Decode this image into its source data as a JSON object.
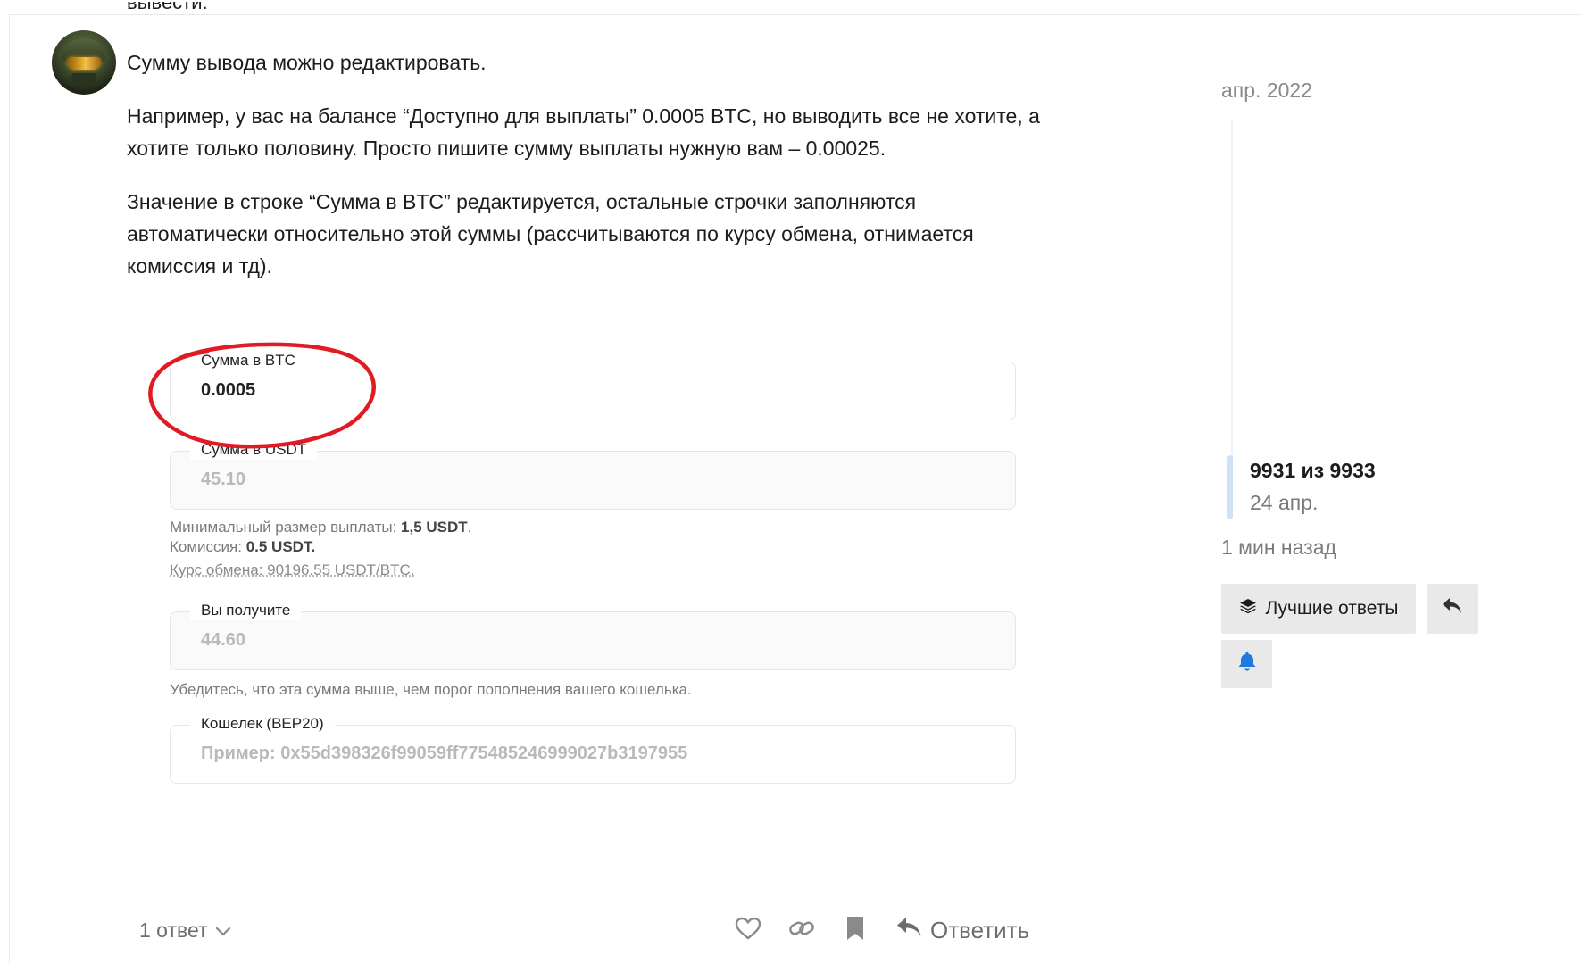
{
  "post": {
    "cut_text": "вывести.",
    "paragraphs": [
      "Сумму вывода можно редактировать.",
      "Например, у вас на балансе “Доступно для выплаты” 0.0005 BTC, но выводить все не хотите, а хотите только половину. Просто пишите сумму выплаты нужную вам – 0.00025.",
      "Значение в строке “Сумма в BTC” редактируется, остальные строчки заполняются автоматически относительно этой суммы (рассчитываются по курсу обмена, отнимается комиссия и тд)."
    ]
  },
  "screenshot": {
    "btc_field": {
      "label": "Сумма в BTC",
      "value": "0.0005"
    },
    "usdt_field": {
      "label": "Сумма в USDT",
      "value": "45.10"
    },
    "min_payout": {
      "label": "Минимальный размер выплаты: ",
      "value": "1,5 USDT",
      "suffix": "."
    },
    "fee": {
      "label": "Комиссия: ",
      "value": "0.5 USDT."
    },
    "rate": "Курс обмена: 90196.55 USDT/BTC.",
    "receive_field": {
      "label": "Вы получите",
      "value": "44.60"
    },
    "receive_hint": "Убедитесь, что эта сумма выше, чем порог пополнения вашего кошелька.",
    "wallet_field": {
      "label": "Кошелек (BEP20)",
      "placeholder": "Пример: 0x55d398326f99059ff775485246999027b3197955"
    },
    "highlight_color": "#e01b24"
  },
  "timeline": {
    "start_date": "апр. 2022",
    "position": "9931 из 9933",
    "position_date": "24 апр.",
    "last_activity": "1 мин назад"
  },
  "sidebar_buttons": {
    "best_answers": "Лучшие ответы"
  },
  "footer": {
    "replies": "1 ответ",
    "reply": "Ответить"
  },
  "colors": {
    "accent_blue": "#1f7ae0",
    "muted": "#7a7a7a",
    "button_bg": "#e9e9e9"
  }
}
